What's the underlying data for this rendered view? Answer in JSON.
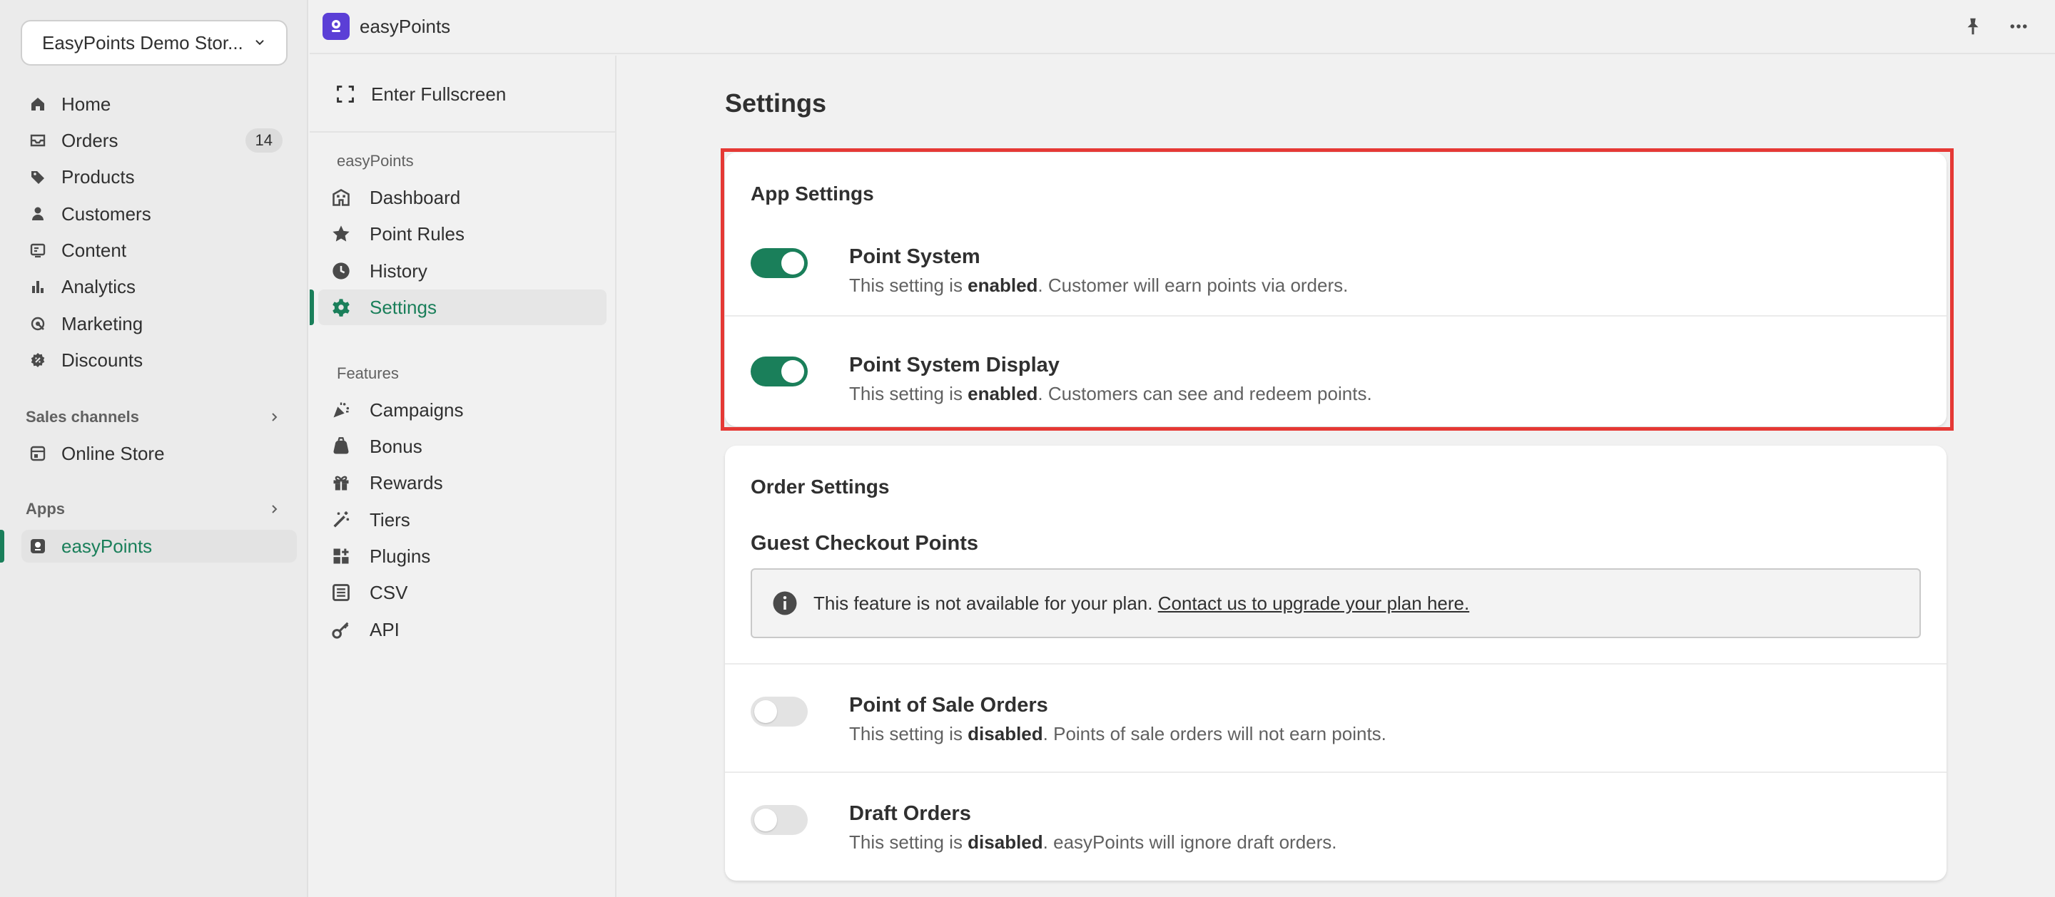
{
  "store": {
    "name": "EasyPoints Demo Stor..."
  },
  "admin_nav": {
    "items": [
      {
        "label": "Home",
        "icon": "home-icon"
      },
      {
        "label": "Orders",
        "icon": "orders-icon",
        "badge": "14"
      },
      {
        "label": "Products",
        "icon": "tag-icon"
      },
      {
        "label": "Customers",
        "icon": "person-icon"
      },
      {
        "label": "Content",
        "icon": "content-icon"
      },
      {
        "label": "Analytics",
        "icon": "bar-chart-icon"
      },
      {
        "label": "Marketing",
        "icon": "target-icon"
      },
      {
        "label": "Discounts",
        "icon": "discount-icon"
      }
    ],
    "sales_channels_label": "Sales channels",
    "online_store": "Online Store",
    "apps_label": "Apps",
    "app_item": "easyPoints"
  },
  "topbar": {
    "title": "easyPoints"
  },
  "app_nav": {
    "fullscreen": "Enter Fullscreen",
    "section1": "easyPoints",
    "items1": [
      {
        "label": "Dashboard",
        "icon": "dashboard-icon"
      },
      {
        "label": "Point Rules",
        "icon": "star-icon"
      },
      {
        "label": "History",
        "icon": "clock-icon"
      },
      {
        "label": "Settings",
        "icon": "gear-icon"
      }
    ],
    "section2": "Features",
    "items2": [
      {
        "label": "Campaigns",
        "icon": "party-icon"
      },
      {
        "label": "Bonus",
        "icon": "bag-icon"
      },
      {
        "label": "Rewards",
        "icon": "gift-icon"
      },
      {
        "label": "Tiers",
        "icon": "wand-icon"
      },
      {
        "label": "Plugins",
        "icon": "plugin-icon"
      },
      {
        "label": "CSV",
        "icon": "list-icon"
      },
      {
        "label": "API",
        "icon": "key-icon"
      }
    ]
  },
  "page": {
    "title": "Settings"
  },
  "app_settings": {
    "title": "App Settings",
    "point_system": {
      "title": "Point System",
      "prefix": "This setting is ",
      "state": "enabled",
      "suffix": ". Customer will earn points via orders.",
      "enabled": true
    },
    "point_display": {
      "title": "Point System Display",
      "prefix": "This setting is ",
      "state": "enabled",
      "suffix": ". Customers can see and redeem points.",
      "enabled": true
    }
  },
  "order_settings": {
    "title": "Order Settings",
    "guest_title": "Guest Checkout Points",
    "banner_text": "This feature is not available for your plan. ",
    "banner_link": "Contact us to upgrade your plan here.",
    "pos": {
      "title": "Point of Sale Orders",
      "prefix": "This setting is ",
      "state": "disabled",
      "suffix": ". Points of sale orders will not earn points.",
      "enabled": false
    },
    "draft": {
      "title": "Draft Orders",
      "prefix": "This setting is ",
      "state": "disabled",
      "suffix": ". easyPoints will ignore draft orders.",
      "enabled": false
    }
  },
  "colors": {
    "accent": "#1a7f5a",
    "highlight": "#e53935",
    "app_logo": "#5b3fd6"
  }
}
